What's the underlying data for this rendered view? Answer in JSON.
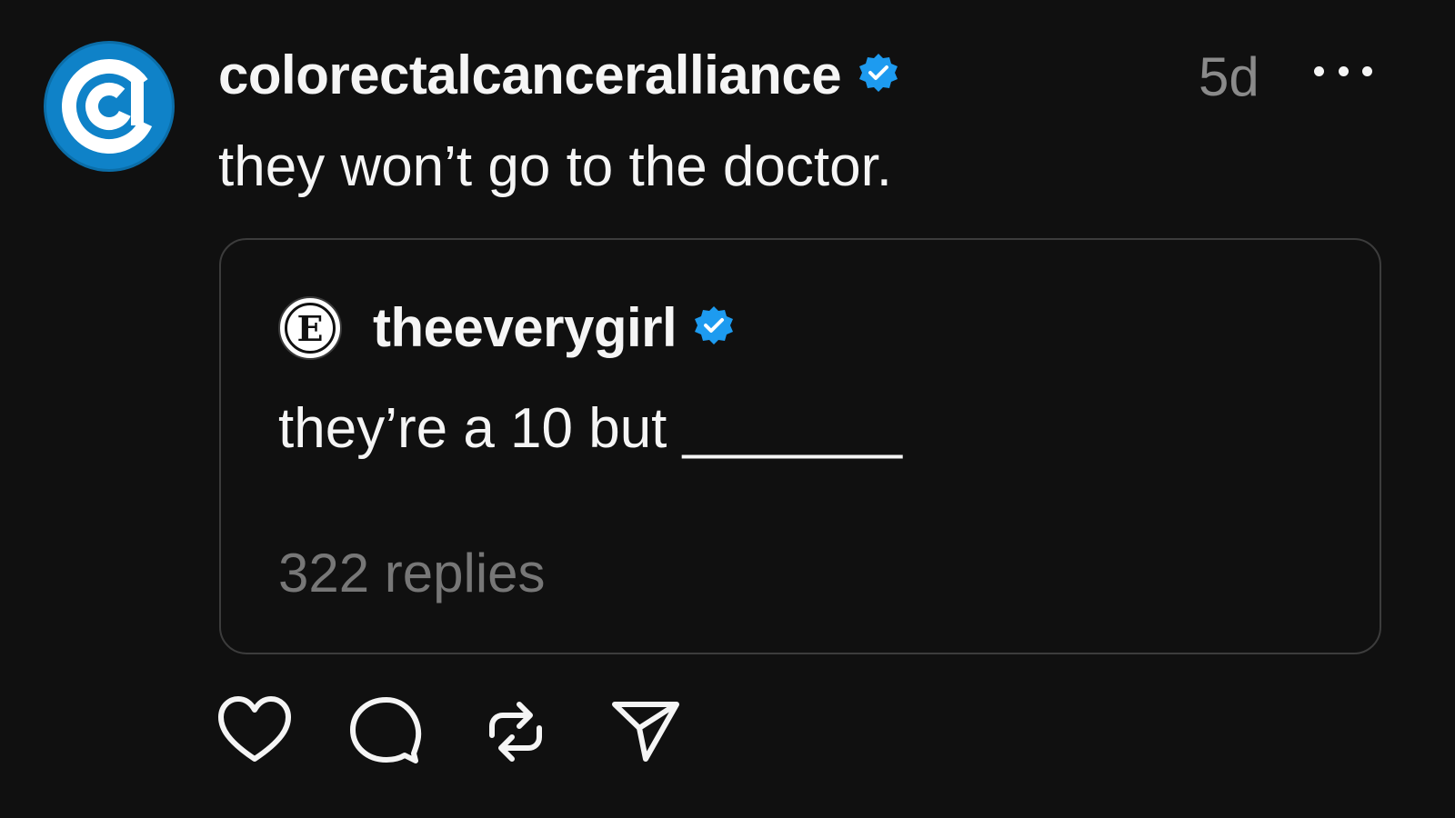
{
  "post": {
    "author": "colorectalcanceralliance",
    "timestamp": "5d",
    "text": "they won’t go to the doctor.",
    "avatar_icon": "colorectal-cancer-alliance-logo",
    "verified_icon": "verified-badge-icon",
    "more_icon": "more-options-icon"
  },
  "quote": {
    "author": "theeverygirl",
    "avatar_letter": "E",
    "text": "they’re a 10 but _______",
    "replies": "322 replies"
  },
  "actions": {
    "like_icon": "heart-icon",
    "reply_icon": "comment-bubble-icon",
    "repost_icon": "repost-icon",
    "share_icon": "send-icon"
  },
  "colors": {
    "background": "#101010",
    "text": "#f5f5f5",
    "muted": "#8a8a8a",
    "verified": "#1d9bf0",
    "brand": "#0f82c8"
  }
}
